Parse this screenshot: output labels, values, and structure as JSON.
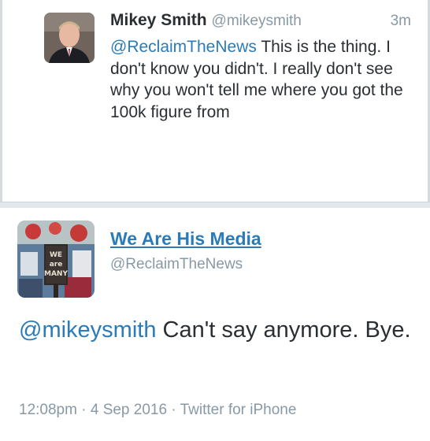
{
  "reply_tweet": {
    "author_name": "Mikey Smith",
    "author_handle": "@mikeysmith",
    "time_ago": "3m",
    "mention": "@ReclaimTheNews",
    "text": " This is the thing. I don't know you didn't. I really don't see why you won't tell me where you got the 100k figure from"
  },
  "main_tweet": {
    "author_name": "We Are His Media",
    "author_handle": "@ReclaimTheNews",
    "mention": "@mikeysmith",
    "text": " Can't say anymore. Bye.",
    "time": "12:08pm",
    "date": "4 Sep 2016",
    "source": "Twitter for iPhone",
    "separator": " · ",
    "avatar_sign_text": [
      "WE",
      "are",
      "MANY"
    ]
  },
  "colors": {
    "link": "#2b7bb9",
    "muted": "#8899a6",
    "text": "#292f33",
    "divider": "#e1e8ed"
  }
}
